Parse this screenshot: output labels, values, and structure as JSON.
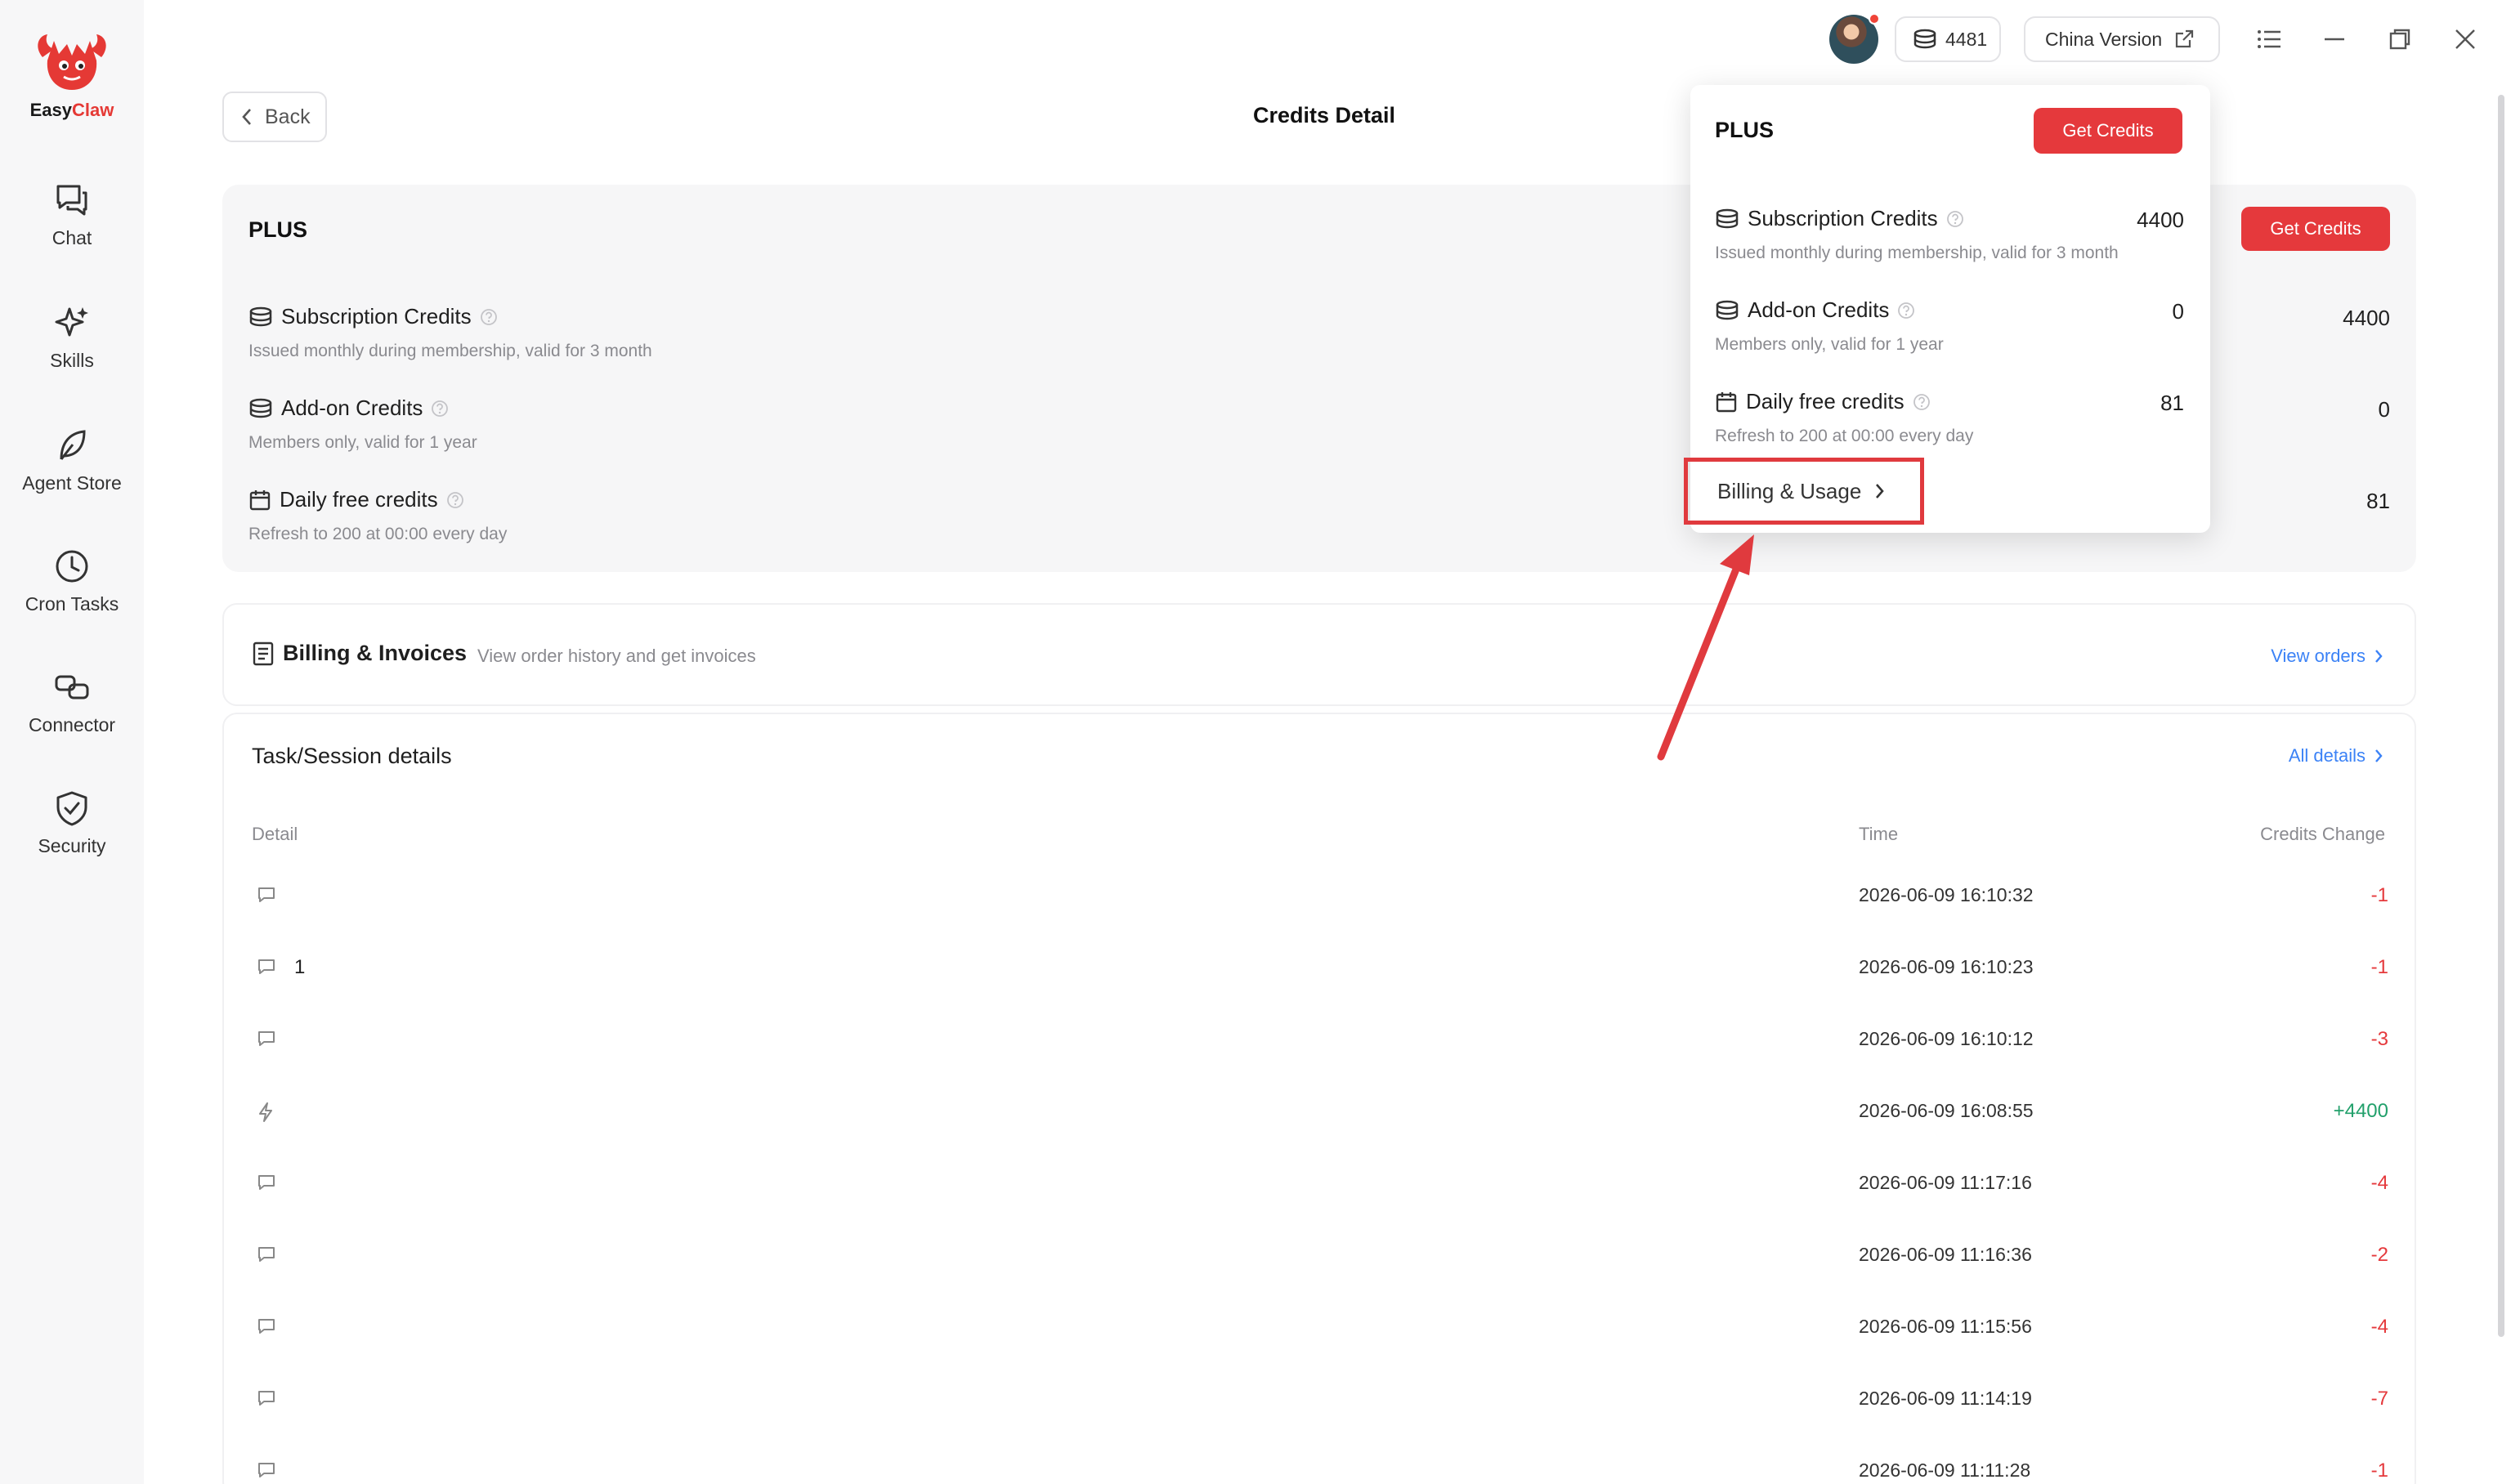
{
  "app": {
    "name_part1": "Easy",
    "name_part2": "Claw"
  },
  "sidebar": {
    "items": [
      {
        "label": "Chat",
        "icon": "chat-icon"
      },
      {
        "label": "Skills",
        "icon": "sparkle-icon"
      },
      {
        "label": "Agent Store",
        "icon": "leaf-icon"
      },
      {
        "label": "Cron Tasks",
        "icon": "clock-icon"
      },
      {
        "label": "Connector",
        "icon": "link-icon"
      },
      {
        "label": "Security",
        "icon": "shield-icon"
      }
    ]
  },
  "topbar": {
    "credits": "4481",
    "china_version": "China Version"
  },
  "header": {
    "back_label": "Back",
    "title": "Credits Detail"
  },
  "plan": {
    "name": "PLUS",
    "get_credits_label": "Get Credits",
    "rows": [
      {
        "title": "Subscription Credits",
        "desc": "Issued monthly during membership, valid for 3 month",
        "value": "4400"
      },
      {
        "title": "Add-on Credits",
        "desc": "Members only, valid for 1 year",
        "value": "0"
      },
      {
        "title": "Daily free credits",
        "desc": "Refresh to 200 at 00:00 every day",
        "value": "81"
      }
    ]
  },
  "billing": {
    "title": "Billing & Invoices",
    "desc": "View order history and get invoices",
    "link": "View orders"
  },
  "tasks": {
    "title": "Task/Session details",
    "all_link": "All details",
    "columns": {
      "detail": "Detail",
      "time": "Time",
      "change": "Credits Change"
    },
    "rows": [
      {
        "detail": "",
        "time": "2026-06-09 16:10:32",
        "change": "-1",
        "type": "chat",
        "positive": false
      },
      {
        "detail": "1",
        "time": "2026-06-09 16:10:23",
        "change": "-1",
        "type": "chat",
        "positive": false
      },
      {
        "detail": "",
        "time": "2026-06-09 16:10:12",
        "change": "-3",
        "type": "chat",
        "positive": false
      },
      {
        "detail": "",
        "time": "2026-06-09 16:08:55",
        "change": "+4400",
        "type": "bolt",
        "positive": true
      },
      {
        "detail": "",
        "time": "2026-06-09 11:17:16",
        "change": "-4",
        "type": "chat",
        "positive": false
      },
      {
        "detail": "",
        "time": "2026-06-09 11:16:36",
        "change": "-2",
        "type": "chat",
        "positive": false
      },
      {
        "detail": "",
        "time": "2026-06-09 11:15:56",
        "change": "-4",
        "type": "chat",
        "positive": false
      },
      {
        "detail": "",
        "time": "2026-06-09 11:14:19",
        "change": "-7",
        "type": "chat",
        "positive": false
      },
      {
        "detail": "",
        "time": "2026-06-09 11:11:28",
        "change": "-1",
        "type": "chat",
        "positive": false
      }
    ]
  },
  "popover": {
    "plan_name": "PLUS",
    "get_credits_label": "Get Credits",
    "rows": [
      {
        "title": "Subscription Credits",
        "desc": "Issued monthly during membership, valid for 3 month",
        "value": "4400"
      },
      {
        "title": "Add-on Credits",
        "desc": "Members only, valid for 1 year",
        "value": "0"
      },
      {
        "title": "Daily free credits",
        "desc": "Refresh to 200 at 00:00 every day",
        "value": "81"
      }
    ],
    "billing_usage_label": "Billing & Usage"
  },
  "colors": {
    "accent": "#e5393c",
    "link": "#3b82f6",
    "positive": "#22a06b",
    "negative": "#e5393c",
    "highlight": "#e03a3e"
  }
}
